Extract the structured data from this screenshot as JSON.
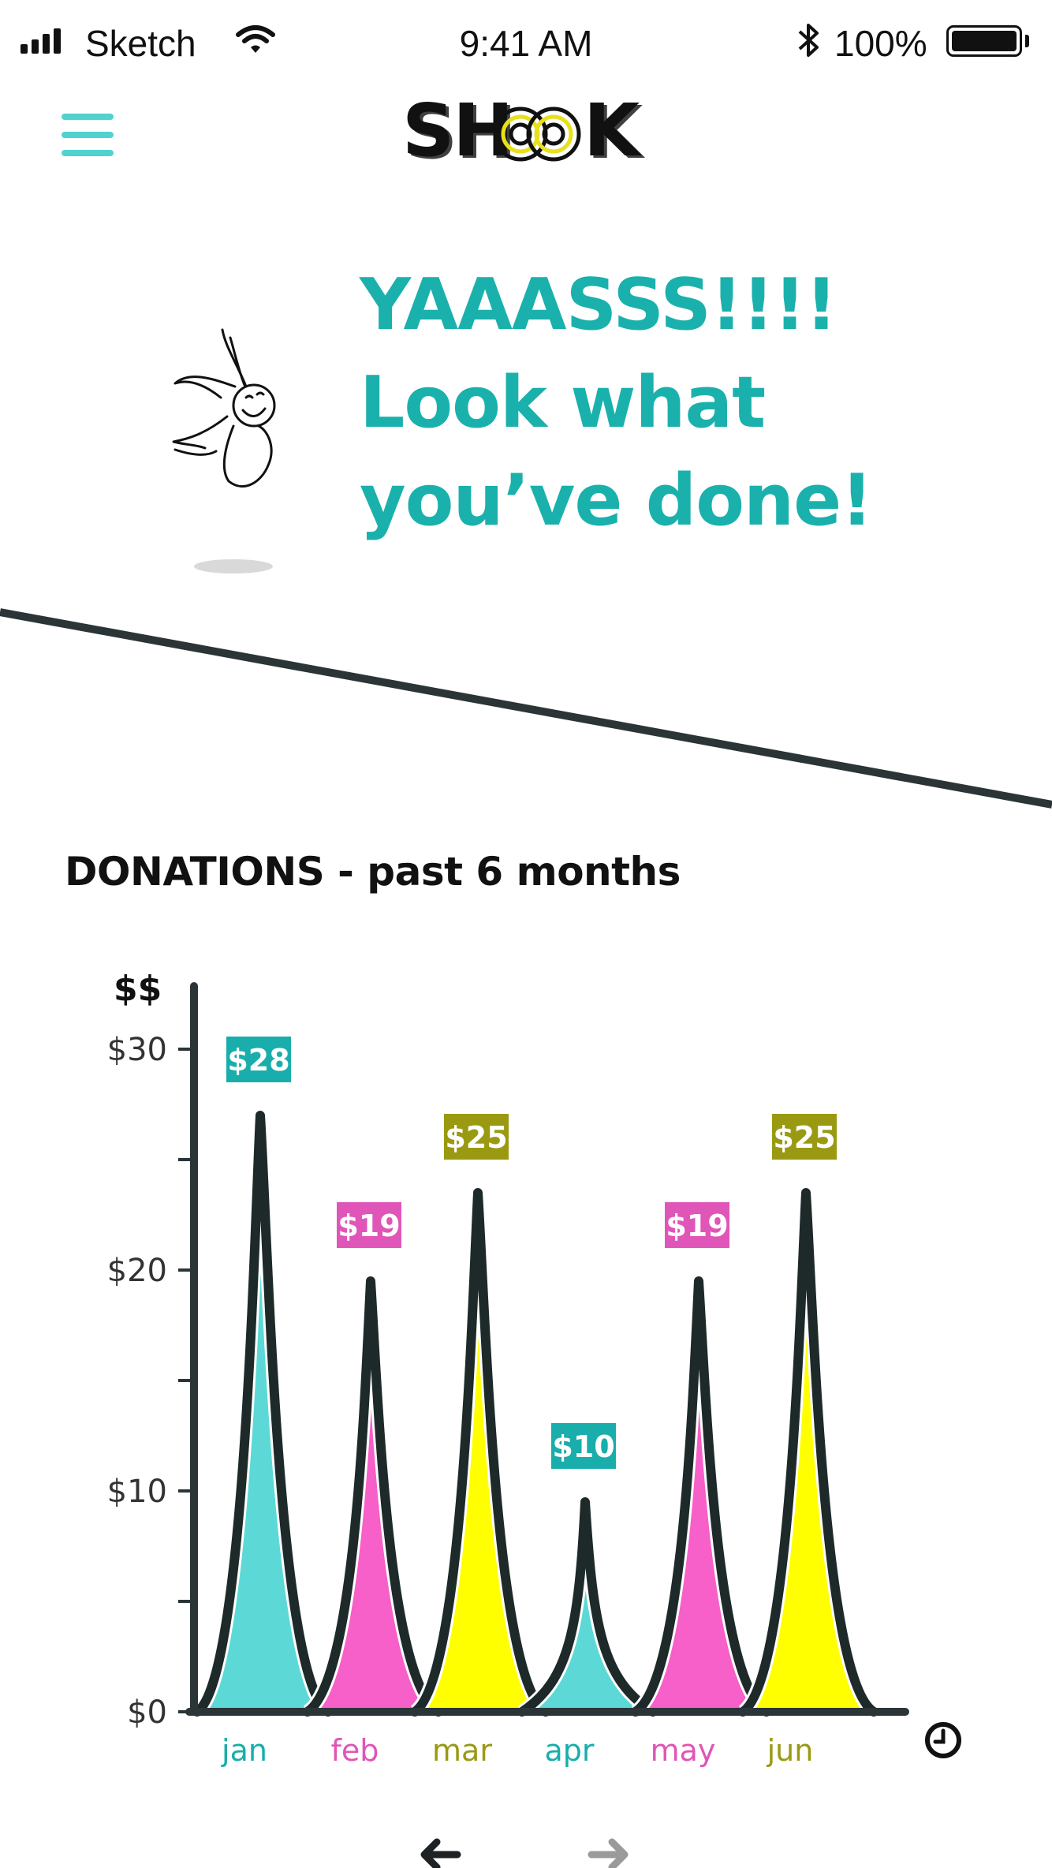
{
  "status_bar": {
    "carrier": "Sketch",
    "time": "9:41 AM",
    "battery": "100%"
  },
  "header": {
    "logo_text": "SHOOK",
    "menu_icon": "hamburger-menu-icon"
  },
  "hero": {
    "headline_lines": [
      "YAAASSS!!!!",
      "Look what",
      "you’ve done!"
    ],
    "illustration_icon": "jumping-stick-figure"
  },
  "donations": {
    "title": "DONATIONS - past 6 months"
  },
  "chart_data": {
    "type": "area",
    "ylabel": "$$",
    "ylim": [
      0,
      30
    ],
    "yticks": [
      "$0",
      "$10",
      "$20",
      "$30"
    ],
    "categories": [
      "jan",
      "feb",
      "mar",
      "apr",
      "may",
      "jun"
    ],
    "values": [
      28,
      19,
      25,
      10,
      19,
      25
    ],
    "plotted_peaks": [
      27,
      19.5,
      23.5,
      9.5,
      19.5,
      23.5
    ],
    "value_labels": [
      "$28",
      "$19",
      "$25",
      "$10",
      "$19",
      "$25"
    ],
    "colors": [
      "#5cd9d6",
      "#f75fc9",
      "#ffff00",
      "#5cd9d6",
      "#f75fc9",
      "#ffff00"
    ],
    "label_colors": [
      "#19aeab",
      "#e055b8",
      "#9a9a12",
      "#19aeab",
      "#e055b8",
      "#9a9a12"
    ],
    "x_axis_icon": "clock-icon",
    "grid": false
  },
  "pagination": {
    "prev_icon": "arrow-left-icon",
    "next_icon": "arrow-right-icon"
  },
  "colors": {
    "accent": "#1ab1ad",
    "menu": "#50d2d0",
    "axis": "#2b3436"
  }
}
